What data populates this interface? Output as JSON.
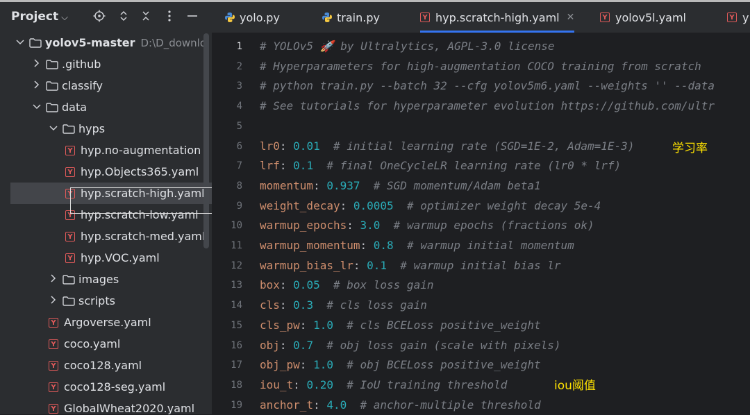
{
  "project": {
    "title": "Project",
    "tree": [
      {
        "label": "yolov5-master",
        "path": "D:\\D_downlo",
        "type": "folder",
        "open": true,
        "level": 0
      },
      {
        "label": ".github",
        "type": "folder",
        "open": false,
        "level": 1
      },
      {
        "label": "classify",
        "type": "folder",
        "open": false,
        "level": 1
      },
      {
        "label": "data",
        "type": "folder",
        "open": true,
        "level": 1
      },
      {
        "label": "hyps",
        "type": "folder",
        "open": true,
        "level": 2
      },
      {
        "label": "hyp.no-augmentation",
        "type": "yaml",
        "level": 3
      },
      {
        "label": "hyp.Objects365.yaml",
        "type": "yaml",
        "level": 3
      },
      {
        "label": "hyp.scratch-high.yaml",
        "type": "yaml",
        "level": 3,
        "selected": true
      },
      {
        "label": "hyp.scratch-low.yaml",
        "type": "yaml",
        "level": 3
      },
      {
        "label": "hyp.scratch-med.yaml",
        "type": "yaml",
        "level": 3
      },
      {
        "label": "hyp.VOC.yaml",
        "type": "yaml",
        "level": 3
      },
      {
        "label": "images",
        "type": "folder",
        "open": false,
        "level": 2
      },
      {
        "label": "scripts",
        "type": "folder",
        "open": false,
        "level": 2
      },
      {
        "label": "Argoverse.yaml",
        "type": "yaml",
        "level": 2
      },
      {
        "label": "coco.yaml",
        "type": "yaml",
        "level": 2
      },
      {
        "label": "coco128.yaml",
        "type": "yaml",
        "level": 2
      },
      {
        "label": "coco128-seg.yaml",
        "type": "yaml",
        "level": 2
      },
      {
        "label": "GlobalWheat2020.yaml",
        "type": "yaml",
        "level": 2
      }
    ]
  },
  "tabs": [
    {
      "label": "yolo.py",
      "type": "py"
    },
    {
      "label": "train.py",
      "type": "py"
    },
    {
      "label": "hyp.scratch-high.yaml",
      "type": "yaml",
      "active": true
    },
    {
      "label": "yolov5l.yaml",
      "type": "yaml"
    },
    {
      "label": "y",
      "type": "yaml"
    }
  ],
  "editor": {
    "lines": [
      {
        "n": "1",
        "text": "# YOLOv5 🚀 by Ultralytics, AGPL-3.0 license"
      },
      {
        "n": "2",
        "text": "# Hyperparameters for high-augmentation COCO training from scratch"
      },
      {
        "n": "3",
        "text": "# python train.py --batch 32 --cfg yolov5m6.yaml --weights '' --data"
      },
      {
        "n": "4",
        "text": "# See tutorials for hyperparameter evolution https://github.com/ultr"
      },
      {
        "n": "5",
        "text": ""
      },
      {
        "n": "6",
        "key": "lr0",
        "value": "0.01",
        "comment": "# initial learning rate (SGD=1E-2, Adam=1E-3)"
      },
      {
        "n": "7",
        "key": "lrf",
        "value": "0.1",
        "comment": "# final OneCycleLR learning rate (lr0 * lrf)"
      },
      {
        "n": "8",
        "key": "momentum",
        "value": "0.937",
        "comment": "# SGD momentum/Adam beta1"
      },
      {
        "n": "9",
        "key": "weight_decay",
        "value": "0.0005",
        "comment": "# optimizer weight decay 5e-4"
      },
      {
        "n": "10",
        "key": "warmup_epochs",
        "value": "3.0",
        "comment": "# warmup epochs (fractions ok)"
      },
      {
        "n": "11",
        "key": "warmup_momentum",
        "value": "0.8",
        "comment": "# warmup initial momentum"
      },
      {
        "n": "12",
        "key": "warmup_bias_lr",
        "value": "0.1",
        "comment": "# warmup initial bias lr"
      },
      {
        "n": "13",
        "key": "box",
        "value": "0.05",
        "comment": "# box loss gain"
      },
      {
        "n": "14",
        "key": "cls",
        "value": "0.3",
        "comment": "# cls loss gain"
      },
      {
        "n": "15",
        "key": "cls_pw",
        "value": "1.0",
        "comment": "# cls BCELoss positive_weight"
      },
      {
        "n": "16",
        "key": "obj",
        "value": "0.7",
        "comment": "# obj loss gain (scale with pixels)"
      },
      {
        "n": "17",
        "key": "obj_pw",
        "value": "1.0",
        "comment": "# obj BCELoss positive_weight"
      },
      {
        "n": "18",
        "key": "iou_t",
        "value": "0.20",
        "comment": "# IoU training threshold"
      },
      {
        "n": "19",
        "key": "anchor_t",
        "value": "4.0",
        "comment": "# anchor-multiple threshold"
      }
    ],
    "annotations": {
      "lr0": "学习率",
      "iou": "iou阈值"
    }
  }
}
